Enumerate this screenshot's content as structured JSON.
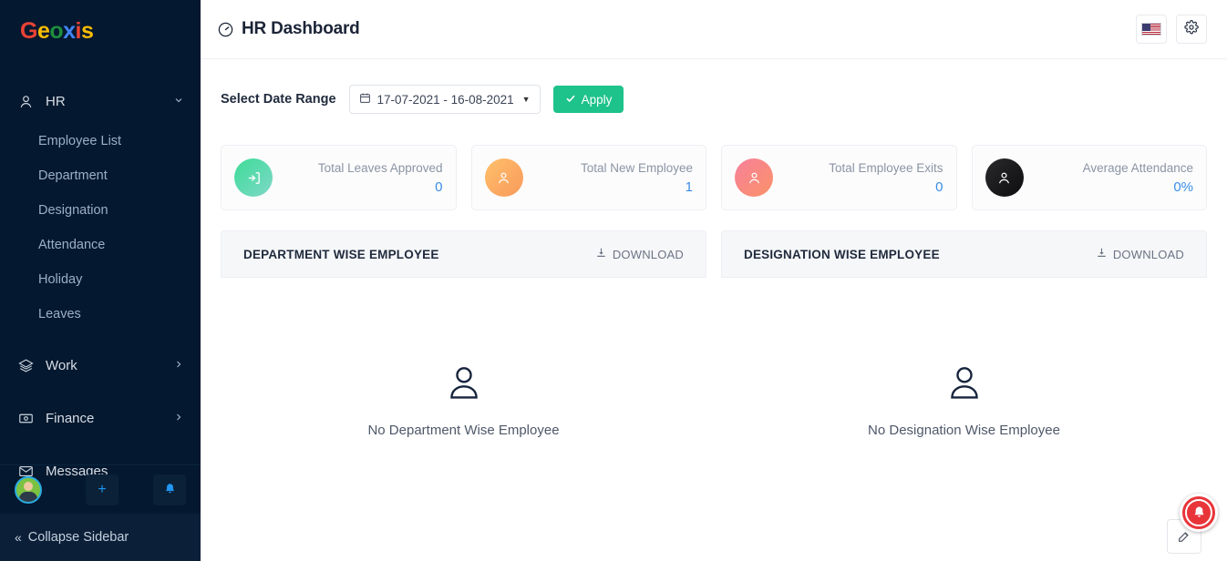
{
  "brand": {
    "letters": [
      {
        "char": "G",
        "color": "#ea4335"
      },
      {
        "char": "e",
        "color": "#fbbc05"
      },
      {
        "char": "o",
        "color": "#1e8e3e"
      },
      {
        "char": "x",
        "color": "#4285f4"
      },
      {
        "char": "i",
        "color": "#ea4335"
      },
      {
        "char": "s",
        "color": "#fbbc05"
      }
    ]
  },
  "sidebar": {
    "groups": [
      {
        "label": "HR",
        "icon": "user-icon",
        "chevron": "chevron-down-icon",
        "expanded": true,
        "items": [
          {
            "label": "Employee List"
          },
          {
            "label": "Department"
          },
          {
            "label": "Designation"
          },
          {
            "label": "Attendance"
          },
          {
            "label": "Holiday"
          },
          {
            "label": "Leaves"
          }
        ]
      },
      {
        "label": "Work",
        "icon": "layers-icon",
        "chevron": "chevron-right-icon",
        "expanded": false,
        "items": []
      },
      {
        "label": "Finance",
        "icon": "money-icon",
        "chevron": "chevron-right-icon",
        "expanded": false,
        "items": []
      },
      {
        "label": "Messages",
        "icon": "envelope-icon",
        "chevron": "",
        "expanded": false,
        "items": []
      }
    ],
    "bottom": {
      "avatar": "user-avatar",
      "add_label": "+",
      "bell_icon": "bell-icon",
      "collapse_label": "Collapse Sidebar",
      "collapse_icon": "double-chevron-left-icon"
    }
  },
  "header": {
    "title": "HR Dashboard",
    "title_icon": "gauge-icon",
    "language_icon": "us-flag-icon",
    "settings_icon": "gear-icon"
  },
  "filters": {
    "label": "Select Date Range",
    "date_range": "17-07-2021 - 16-08-2021",
    "calendar_icon": "calendar-icon",
    "caret_icon": "caret-down-icon",
    "apply_label": "Apply",
    "apply_icon": "check-icon",
    "apply_color": "#1ec28b"
  },
  "stats": [
    {
      "label": "Total Leaves Approved",
      "value": "0",
      "icon": "sign-out-icon",
      "color_class": "c-teal"
    },
    {
      "label": "Total New Employee",
      "value": "1",
      "icon": "user-icon",
      "color_class": "c-orange"
    },
    {
      "label": "Total Employee Exits",
      "value": "0",
      "icon": "user-icon",
      "color_class": "c-pink"
    },
    {
      "label": "Average Attendance",
      "value": "0%",
      "icon": "user-icon",
      "color_class": "c-dark"
    }
  ],
  "panels": [
    {
      "title": "DEPARTMENT WISE EMPLOYEE",
      "download_label": "DOWNLOAD",
      "download_icon": "download-icon",
      "empty_icon": "user-outline-icon",
      "empty_text": "No Department Wise Employee"
    },
    {
      "title": "DESIGNATION WISE EMPLOYEE",
      "download_label": "DOWNLOAD",
      "download_icon": "download-icon",
      "empty_icon": "user-outline-icon",
      "empty_text": "No Designation Wise Employee"
    }
  ],
  "floating": {
    "edit_icon": "edit-pencil-icon",
    "notification_icon": "bell-icon",
    "notification_color": "#e8353a"
  },
  "colors": {
    "sidebar_bg": "#04182f",
    "accent_blue": "#3a8ee6",
    "apply_green": "#1ec28b",
    "title_dark": "#1b2437"
  }
}
